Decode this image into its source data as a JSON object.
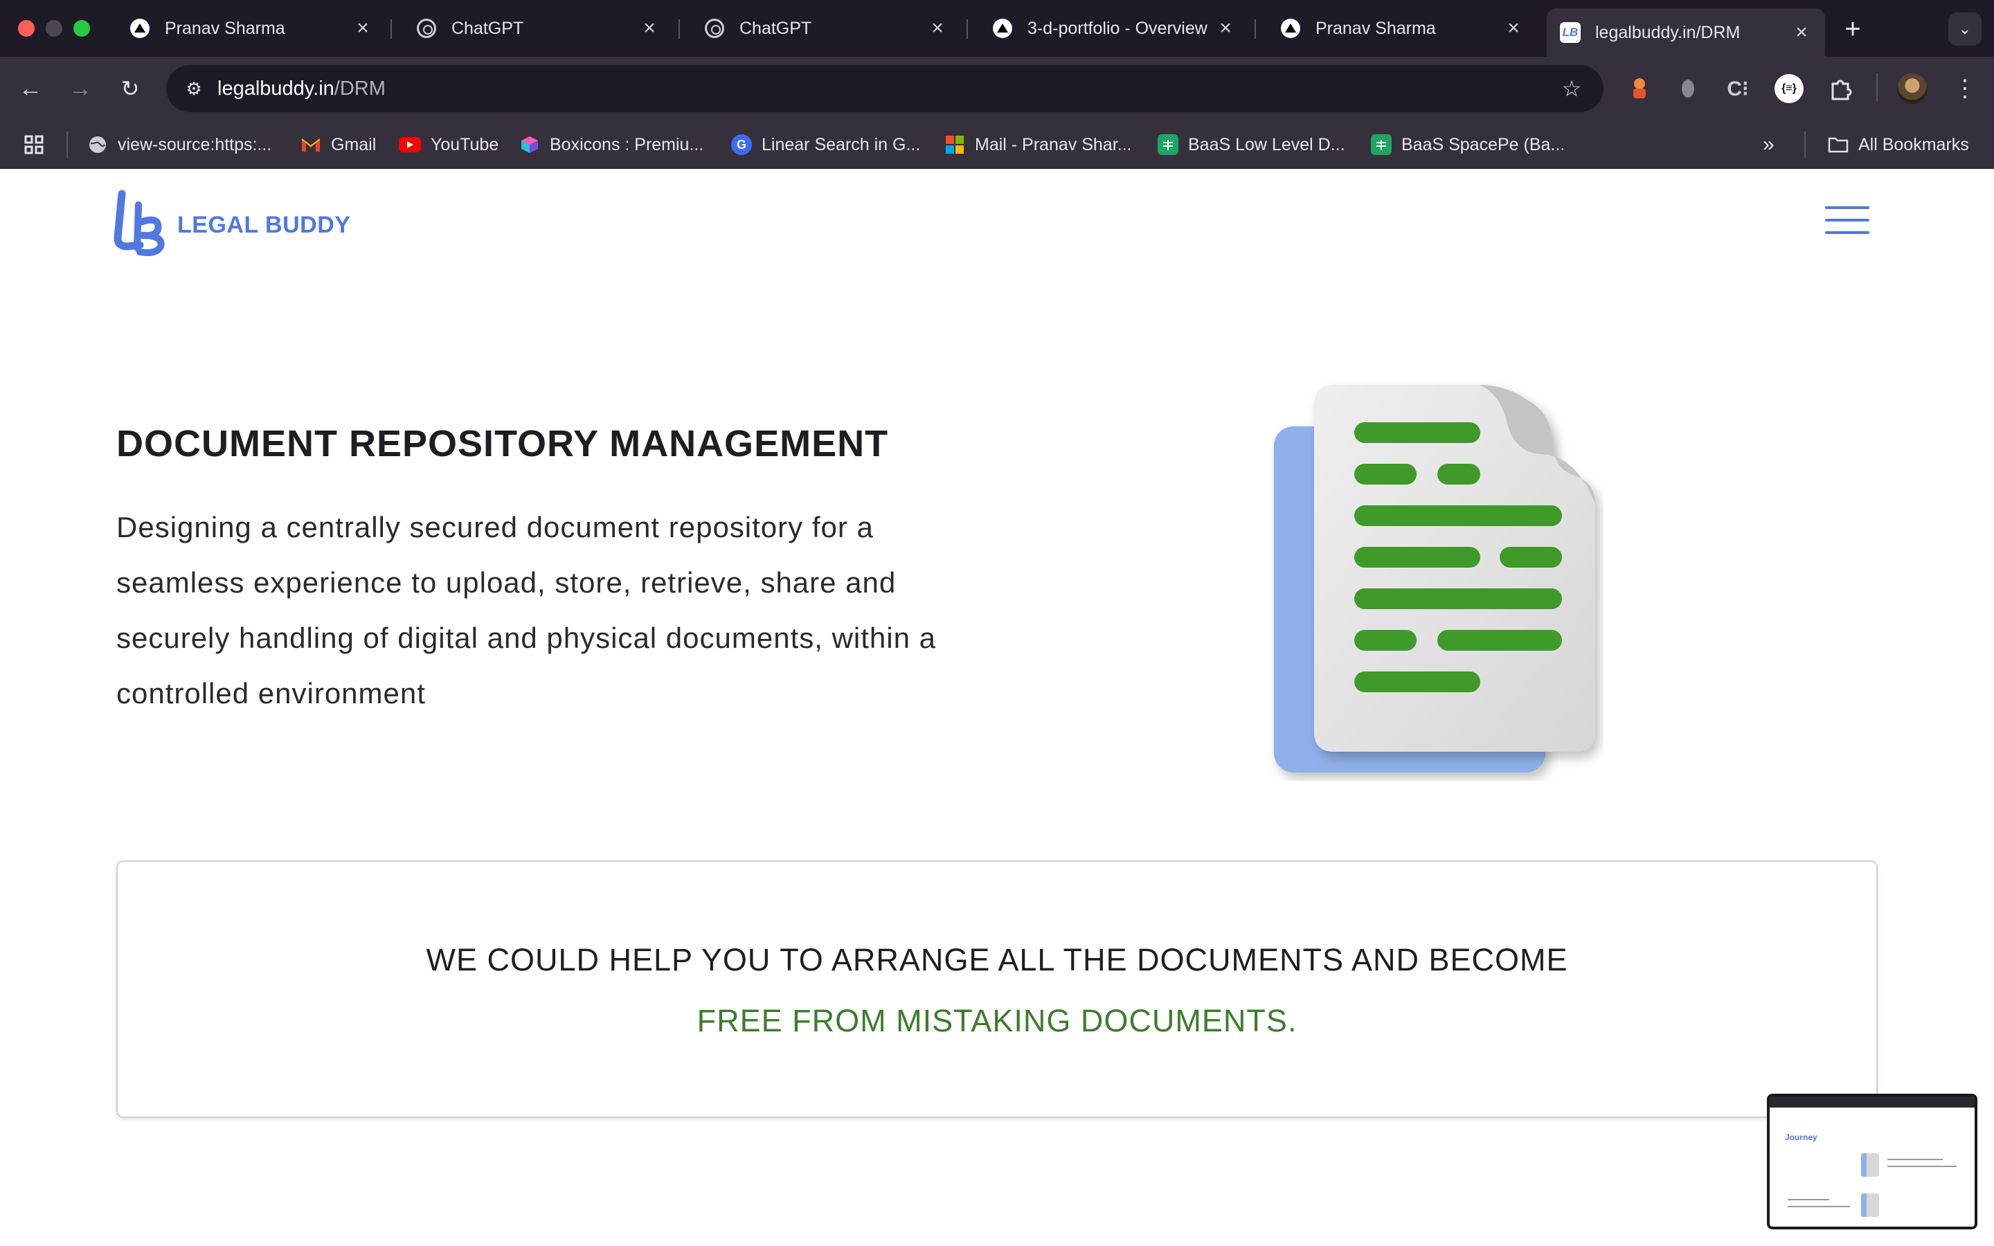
{
  "browser": {
    "tabs": [
      {
        "title": "Pranav Sharma",
        "favicon": "triangle-icon",
        "active": false
      },
      {
        "title": "ChatGPT",
        "favicon": "chatgpt-icon",
        "active": false
      },
      {
        "title": "ChatGPT",
        "favicon": "chatgpt-icon",
        "active": false
      },
      {
        "title": "3-d-portfolio - Overview",
        "favicon": "triangle-icon",
        "active": false
      },
      {
        "title": "Pranav Sharma",
        "favicon": "triangle-icon",
        "active": false
      },
      {
        "title": "legalbuddy.in/DRM",
        "favicon": "legalbuddy-icon",
        "active": true
      }
    ],
    "url_host": "legalbuddy.in",
    "url_path": "/DRM",
    "bookmarks": [
      {
        "label": "view-source:https:...",
        "icon": "globe-icon"
      },
      {
        "label": "Gmail",
        "icon": "gmail-icon"
      },
      {
        "label": "YouTube",
        "icon": "youtube-icon"
      },
      {
        "label": "Boxicons : Premiu...",
        "icon": "boxicons-icon"
      },
      {
        "label": "Linear Search in G...",
        "icon": "google-icon"
      },
      {
        "label": "Mail - Pranav Shar...",
        "icon": "microsoft-icon"
      },
      {
        "label": "BaaS Low Level D...",
        "icon": "sheets-icon"
      },
      {
        "label": "BaaS SpacePe (Ba...",
        "icon": "sheets-icon"
      }
    ],
    "all_bookmarks_label": "All Bookmarks",
    "json_ext_label": "{≡}"
  },
  "header": {
    "logo_mark": "LB",
    "logo_text": "LEGAL BUDDY"
  },
  "hero": {
    "heading": "DOCUMENT REPOSITORY MANAGEMENT",
    "description": "Designing a centrally secured document repository for a seamless experience to upload, store, retrieve, share and securely handling of digital and physical documents, within a controlled environment"
  },
  "cta": {
    "line1": "WE COULD HELP YOU TO ARRANGE ALL THE DOCUMENTS AND BECOME",
    "line2": "FREE FROM MISTAKING DOCUMENTS."
  },
  "thumbnail": {
    "title": "Journey"
  },
  "colors": {
    "brand_blue": "#4f78e0",
    "cta_green": "#3c7d2c",
    "doc_green": "#3f9a2a",
    "doc_back_blue": "#8fb0ea"
  }
}
